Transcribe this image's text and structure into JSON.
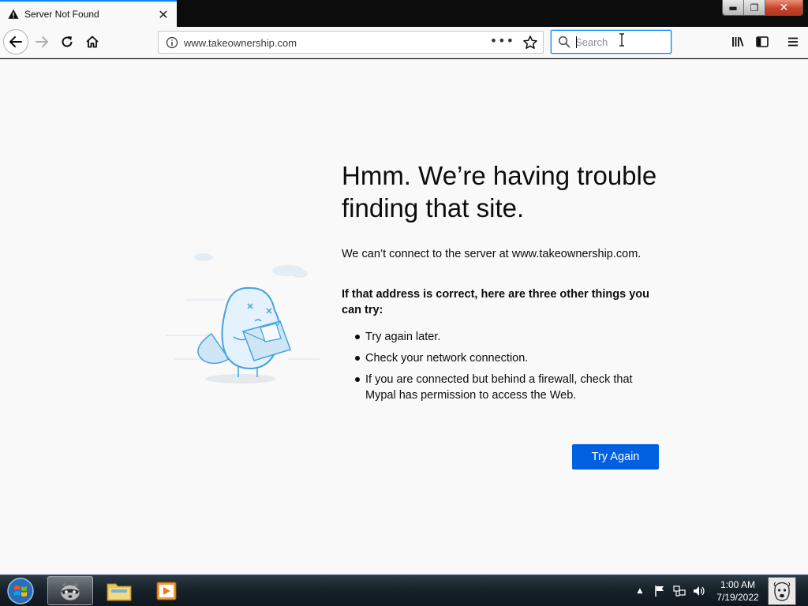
{
  "browser": {
    "tab": {
      "title": "Server Not Found",
      "close_glyph": "✕"
    },
    "window_controls": {
      "minimize": "▬",
      "maximize": "❐",
      "close": "✕"
    },
    "urlbar": {
      "url": "www.takeownership.com",
      "page_actions": "•••"
    },
    "searchbar": {
      "placeholder": "Search",
      "value": ""
    }
  },
  "error_page": {
    "heading": "Hmm. We’re having trouble finding that site.",
    "description": "We can’t connect to the server at www.takeownership.com.",
    "subheading": "If that address is correct, here are three other things you can try:",
    "suggestions": [
      "Try again later.",
      "Check your network connection.",
      "If you are connected but behind a firewall, check that Mypal has permission to access the Web."
    ],
    "button_label": "Try Again"
  },
  "taskbar": {
    "clock_time": "1:00 AM",
    "clock_date": "7/19/2022",
    "tray_expand": "▲"
  },
  "colors": {
    "accent": "#0a84ff",
    "button": "#0060df",
    "content_bg": "#f9f9fa",
    "illustration": "#45a1de"
  }
}
